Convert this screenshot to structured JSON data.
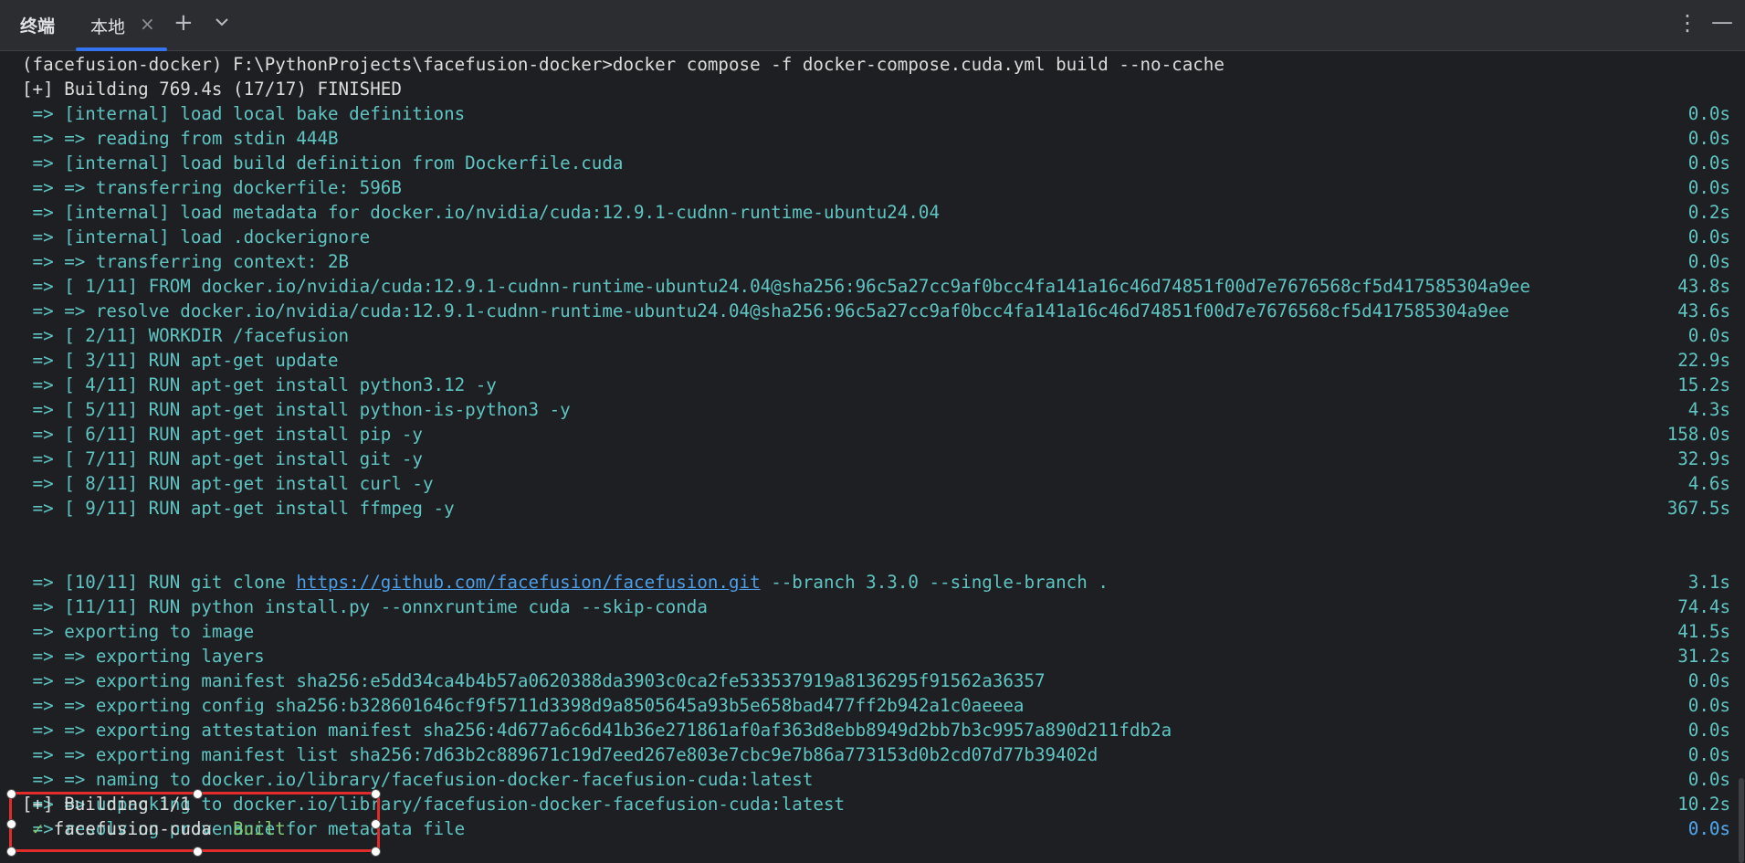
{
  "titlebar": {
    "title": "终端",
    "tab_label": "本地",
    "tab_close": "×",
    "add_tab": "+",
    "more_menu": "⋮",
    "minimize": "—"
  },
  "terminal": {
    "prompt_line": "(facefusion-docker) F:\\PythonProjects\\facefusion-docker>docker compose -f docker-compose.cuda.yml build --no-cache",
    "status_line": "[+] Building 769.4s (17/17) FINISHED",
    "steps": [
      {
        "text": " => [internal] load local bake definitions",
        "time": "0.0s"
      },
      {
        "text": " => => reading from stdin 444B",
        "time": "0.0s"
      },
      {
        "text": " => [internal] load build definition from Dockerfile.cuda",
        "time": "0.0s"
      },
      {
        "text": " => => transferring dockerfile: 596B",
        "time": "0.0s"
      },
      {
        "text": " => [internal] load metadata for docker.io/nvidia/cuda:12.9.1-cudnn-runtime-ubuntu24.04",
        "time": "0.2s"
      },
      {
        "text": " => [internal] load .dockerignore",
        "time": "0.0s"
      },
      {
        "text": " => => transferring context: 2B",
        "time": "0.0s"
      },
      {
        "text": " => [ 1/11] FROM docker.io/nvidia/cuda:12.9.1-cudnn-runtime-ubuntu24.04@sha256:96c5a27cc9af0bcc4fa141a16c46d74851f00d7e7676568cf5d417585304a9ee",
        "time": "43.8s"
      },
      {
        "text": " => => resolve docker.io/nvidia/cuda:12.9.1-cudnn-runtime-ubuntu24.04@sha256:96c5a27cc9af0bcc4fa141a16c46d74851f00d7e7676568cf5d417585304a9ee",
        "time": "43.6s"
      },
      {
        "text": " => [ 2/11] WORKDIR /facefusion",
        "time": "0.0s"
      },
      {
        "text": " => [ 3/11] RUN apt-get update",
        "time": "22.9s"
      },
      {
        "text": " => [ 4/11] RUN apt-get install python3.12 -y",
        "time": "15.2s"
      },
      {
        "text": " => [ 5/11] RUN apt-get install python-is-python3 -y",
        "time": "4.3s"
      },
      {
        "text": " => [ 6/11] RUN apt-get install pip -y",
        "time": "158.0s"
      },
      {
        "text": " => [ 7/11] RUN apt-get install git -y",
        "time": "32.9s"
      },
      {
        "text": " => [ 8/11] RUN apt-get install curl -y",
        "time": "4.6s"
      },
      {
        "text": " => [ 9/11] RUN apt-get install ffmpeg -y",
        "time": "367.5s"
      }
    ],
    "git_step": {
      "prefix": " => [10/11] RUN git clone ",
      "link": "https://github.com/facefusion/facefusion.git",
      "suffix": " --branch 3.3.0 --single-branch .",
      "time": "3.1s"
    },
    "steps_after": [
      {
        "text": " => [11/11] RUN python install.py --onnxruntime cuda --skip-conda",
        "time": "74.4s"
      },
      {
        "text": " => exporting to image",
        "time": "41.5s"
      },
      {
        "text": " => => exporting layers",
        "time": "31.2s"
      },
      {
        "text": " => => exporting manifest sha256:e5dd34ca4b4b57a0620388da3903c0ca2fe533537919a8136295f91562a36357",
        "time": "0.0s"
      },
      {
        "text": " => => exporting config sha256:b328601646cf9f5711d3398d9a8505645a93b5e658bad477ff2b942a1c0aeeea",
        "time": "0.0s"
      },
      {
        "text": " => => exporting attestation manifest sha256:4d677a6c6d41b36e271861af0af363d8ebb8949d2bb7b3c9957a890d211fdb2a",
        "time": "0.0s"
      },
      {
        "text": " => => exporting manifest list sha256:7d63b2c889671c19d7eed267e803e7cbc9e7b86a773153d0b2cd07d77b39402d",
        "time": "0.0s"
      },
      {
        "text": " => => naming to docker.io/library/facefusion-docker-facefusion-cuda:latest",
        "time": "0.0s"
      },
      {
        "text": " => => unpacking to docker.io/library/facefusion-docker-facefusion-cuda:latest",
        "time": "10.2s"
      },
      {
        "text": " => resolving provenance for metadata file",
        "time": "0.0s"
      }
    ],
    "summary_line": "[+] Building 1/1",
    "result": {
      "check": "✓",
      "name": " facefusion-cuda  ",
      "status": "Built",
      "time": "0.0s"
    }
  },
  "colors": {
    "background": "#1e1f22",
    "cyan": "#5fc5c3",
    "link_blue": "#4d9ee6",
    "success_green": "#7fc96f",
    "highlight_red": "#e32b2b",
    "tab_accent": "#3574f0"
  }
}
